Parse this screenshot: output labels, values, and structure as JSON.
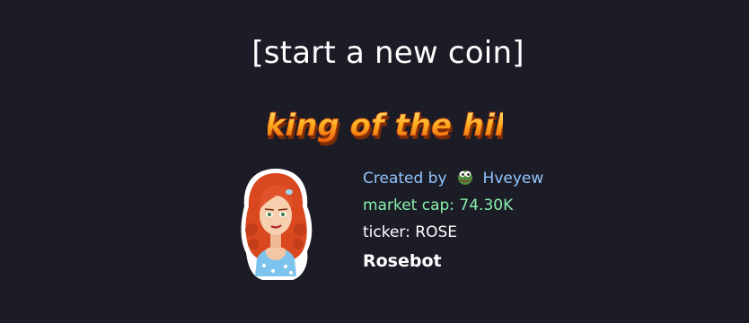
{
  "header": {
    "start_coin_label": "[start a new coin]",
    "king_of_the_hill_text": "king of the hill"
  },
  "coin": {
    "created_by_label": "Created by",
    "creator": "Hveyew",
    "creator_avatar_icon": "pepe-frog-icon",
    "market_cap": "market cap: 74.30K",
    "ticker": "ticker: ROSE",
    "name": "Rosebot"
  },
  "colors": {
    "background": "#1c1c27",
    "created_by": "#93c5fd",
    "market_cap": "#86efac",
    "koth_orange": "#f59e0b"
  }
}
